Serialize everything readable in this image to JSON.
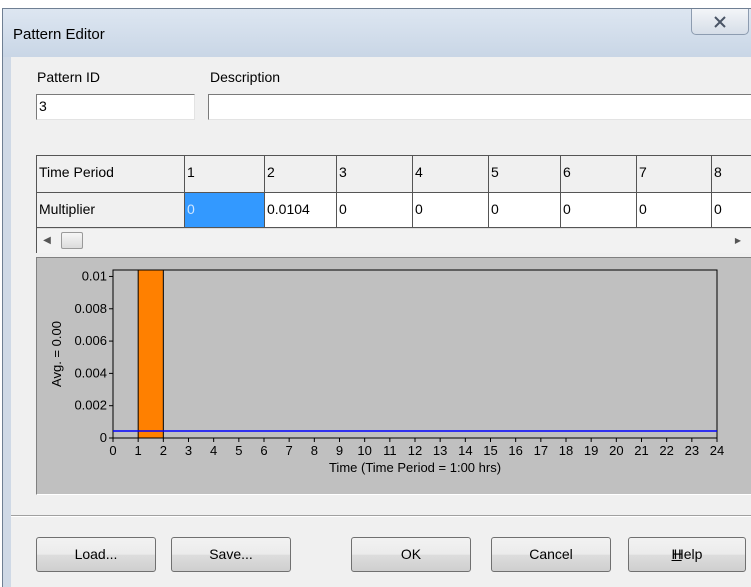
{
  "dialog": {
    "title": "Pattern Editor",
    "close_label": "X"
  },
  "fields": {
    "pattern_id_label": "Pattern ID",
    "pattern_id_value": "3",
    "description_label": "Description",
    "description_value": ""
  },
  "grid": {
    "row_headers": [
      "Time Period",
      "Multiplier"
    ],
    "periods": [
      "1",
      "2",
      "3",
      "4",
      "5",
      "6",
      "7",
      "8"
    ],
    "multipliers": [
      "0",
      "0.0104",
      "0",
      "0",
      "0",
      "0",
      "0",
      "0"
    ],
    "selected_index": 0
  },
  "chart_data": {
    "type": "bar",
    "x": [
      0,
      1,
      2,
      3,
      4,
      5,
      6,
      7,
      8,
      9,
      10,
      11,
      12,
      13,
      14,
      15,
      16,
      17,
      18,
      19,
      20,
      21,
      22,
      23,
      24
    ],
    "bars": [
      {
        "start": 1,
        "end": 2,
        "value": 0.0104
      }
    ],
    "average": 0.000433,
    "xlabel": "Time (Time Period = 1:00 hrs)",
    "ylabel": "Avg. = 0.00",
    "xlim": [
      0,
      24
    ],
    "ylim": [
      0,
      0.0104
    ],
    "yticks": [
      0,
      0.002,
      0.004,
      0.006,
      0.008,
      0.01
    ],
    "ytick_labels": [
      "0",
      "0.002",
      "0.004",
      "0.006",
      "0.008",
      "0.01"
    ],
    "colors": {
      "bar": "#ff8000",
      "average_line": "#0000ff",
      "plot_bg": "#c0c0c0"
    }
  },
  "buttons": {
    "load": "Load...",
    "save": "Save...",
    "ok": "OK",
    "cancel": "Cancel",
    "help": "Help"
  }
}
